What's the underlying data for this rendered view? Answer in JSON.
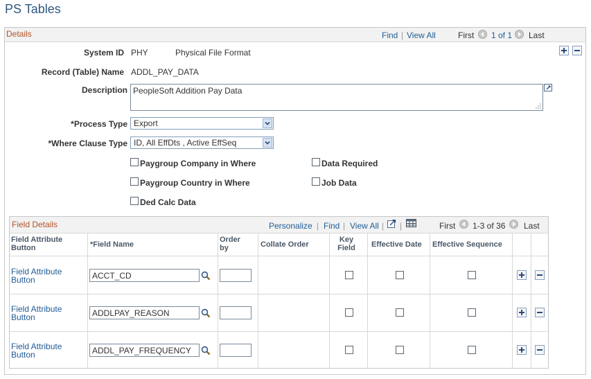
{
  "page": {
    "title": "PS Tables"
  },
  "details": {
    "label": "Details",
    "nav": {
      "find": "Find",
      "view_all": "View All",
      "first": "First",
      "range": "1 of 1",
      "last": "Last",
      "sep": "|"
    }
  },
  "fields": {
    "system_id": {
      "label": "System ID",
      "value": "PHY",
      "desc": "Physical File Format"
    },
    "record_name": {
      "label": "Record (Table) Name",
      "value": "ADDL_PAY_DATA"
    },
    "description": {
      "label": "Description",
      "value": "PeopleSoft Addition Pay Data"
    },
    "process_type": {
      "label": "*Process Type",
      "value": "Export"
    },
    "where_clause": {
      "label": "*Where Clause Type",
      "value": "ID, All EffDts , Active EffSeq"
    }
  },
  "checkboxes": {
    "paygroup_company": "Paygroup Company in Where",
    "paygroup_country": "Paygroup Country in Where",
    "ded_calc": "Ded Calc Data",
    "data_required": "Data Required",
    "job_data": "Job Data"
  },
  "field_details": {
    "label": "Field Details",
    "nav": {
      "personalize": "Personalize",
      "find": "Find",
      "view_all": "View All",
      "first": "First",
      "range": "1-3 of 36",
      "last": "Last",
      "sep": "|"
    },
    "columns": {
      "attr_button": "Field Attribute Button",
      "field_name": "*Field Name",
      "order_by": "Order by",
      "collate_order": "Collate Order",
      "key_field": "Key Field",
      "effective_date": "Effective Date",
      "effective_sequence": "Effective Sequence"
    },
    "rows": [
      {
        "attr_button": "Field Attribute Button",
        "field_name": "ACCT_CD",
        "order_by": ""
      },
      {
        "attr_button": "Field Attribute Button",
        "field_name": "ADDLPAY_REASON",
        "order_by": ""
      },
      {
        "attr_button": "Field Attribute Button",
        "field_name": "ADDL_PAY_FREQUENCY",
        "order_by": ""
      }
    ]
  },
  "colors": {
    "link": "#215c96",
    "section_label": "#b0532a",
    "title": "#305880"
  }
}
